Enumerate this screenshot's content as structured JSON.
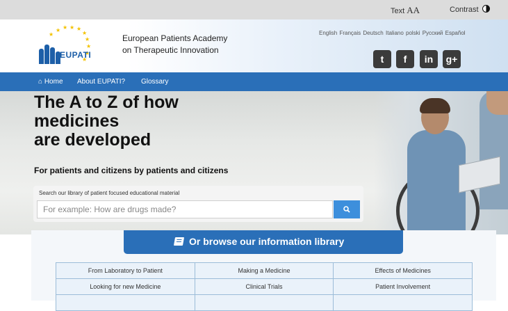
{
  "topbar": {
    "text_label": "Text",
    "text_size_glyph": "AA",
    "contrast_label": "Contrast",
    "contrast_icon": "half-circle-icon"
  },
  "header": {
    "logo_text": "EUPATI",
    "org_line1": "European Patients Academy",
    "org_line2": "on Therapeutic Innovation",
    "languages": [
      "English",
      "Français",
      "Deutsch",
      "Italiano",
      "polski",
      "Русский",
      "Español"
    ],
    "social": [
      {
        "name": "twitter",
        "glyph": "t"
      },
      {
        "name": "facebook",
        "glyph": "f"
      },
      {
        "name": "linkedin",
        "glyph": "in"
      },
      {
        "name": "googleplus",
        "glyph": "g+"
      }
    ]
  },
  "nav": {
    "home": "Home",
    "about": "About EUPATI?",
    "glossary": "Glossary"
  },
  "hero": {
    "title_line1": "The A to Z of how",
    "title_line2": "medicines",
    "title_line3": "are developed",
    "subtitle": "For patients and citizens by patients and citizens"
  },
  "search": {
    "label": "Search our library of patient focused educational material",
    "placeholder": "For example: How are drugs made?"
  },
  "browse": {
    "label": "Or browse our information library"
  },
  "library": {
    "rows": [
      [
        "From Laboratory to Patient",
        "Making a Medicine",
        "Effects of Medicines"
      ],
      [
        "Looking for new Medicine",
        "Clinical Trials",
        "Patient Involvement"
      ],
      [
        "",
        "",
        ""
      ]
    ]
  },
  "colors": {
    "brand_blue": "#2a6fb8",
    "search_button": "#3d8fdc",
    "topbar": "#dcdcdc"
  }
}
